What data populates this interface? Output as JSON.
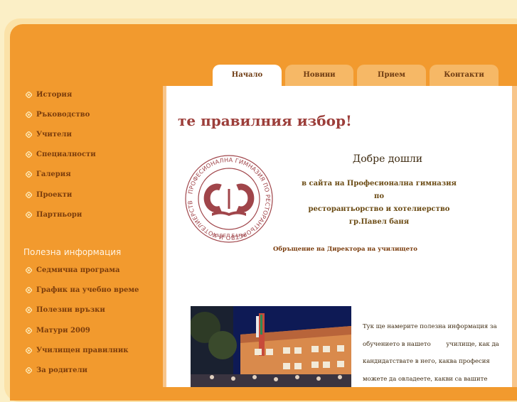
{
  "tabs": [
    {
      "label": "Начало"
    },
    {
      "label": "Новини"
    },
    {
      "label": "Прием"
    },
    {
      "label": "Контакти"
    }
  ],
  "sidebar": {
    "items": [
      {
        "label": "История"
      },
      {
        "label": "Ръководство"
      },
      {
        "label": "Учители"
      },
      {
        "label": "Специалности"
      },
      {
        "label": "Галерия"
      },
      {
        "label": "Проекти"
      },
      {
        "label": "Партньори"
      }
    ],
    "useful_title": "Полезна информация",
    "useful_items": [
      {
        "label": "Седмична програма"
      },
      {
        "label": "График на учебно време"
      },
      {
        "label": "Полезни връзки"
      },
      {
        "label": "Матури 2009"
      },
      {
        "label": "Училищен правилник"
      },
      {
        "label": "За родители"
      }
    ]
  },
  "main": {
    "headline": "те правилния избор!",
    "welcome": "Добре дошли",
    "school_line1": "в сайта на Професионална гимназия по",
    "school_line2": "ресторантьорство и хотелиерство",
    "school_line3": "гр.Павел баня",
    "director_link": "Обръщение на Директора на училището",
    "logo_ring_text": "ПРОФЕСИОНАЛНА ГИМНАЗИЯ ПО РЕСТОРАНТЬОРСТВО И ХОТЕЛИЕРСТВО",
    "logo_bottom_text": "ПАВЕЛ БАНЯ",
    "info_lines": [
      "Тук ще намерите полезна информация за",
      "обучението в нашето        училище, как да",
      "кандидатствате в него, каква професия",
      "можете да овладеете, какви са вашите"
    ]
  },
  "colors": {
    "background": "#fbefc6",
    "frame_orange": "#f29a2e",
    "tab_inactive": "#f6b866",
    "headline": "#9c3e3a",
    "logo": "#a0454a"
  },
  "icons": {
    "nav_bullet": "diamond-bullet-icon"
  }
}
